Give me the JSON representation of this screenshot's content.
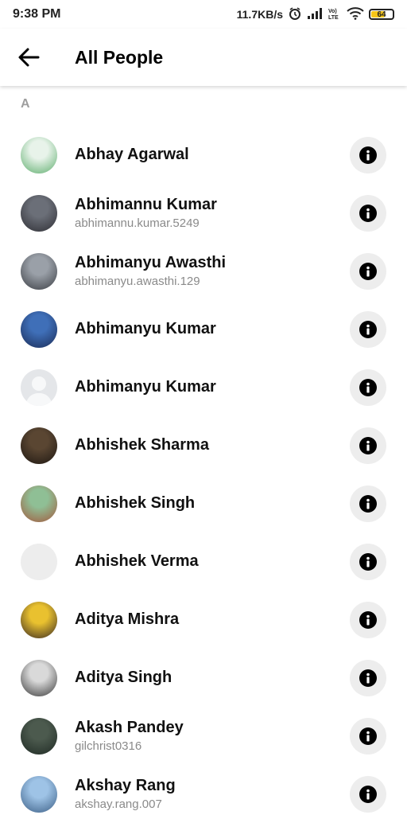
{
  "status_bar": {
    "time": "9:38 PM",
    "speed": "11.7KB/s",
    "battery": "64",
    "battery_level": 0.64,
    "icons": [
      "alarm-icon",
      "signal-icon",
      "volte-icon",
      "wifi-icon",
      "battery-icon"
    ]
  },
  "header": {
    "title": "All People",
    "back_icon": "back-arrow-icon"
  },
  "section": {
    "letter": "A"
  },
  "people": [
    {
      "name": "Abhay Agarwal",
      "username": "",
      "avatar_colors": [
        "#e8f3ea",
        "#5fae6e"
      ]
    },
    {
      "name": "Abhimannu Kumar",
      "username": "abhimannu.kumar.5249",
      "avatar_colors": [
        "#6b6f78",
        "#2f2f35"
      ]
    },
    {
      "name": "Abhimanyu Awasthi",
      "username": "abhimanyu.awasthi.129",
      "avatar_colors": [
        "#9aa0a8",
        "#3b3e44"
      ]
    },
    {
      "name": "Abhimanyu Kumar",
      "username": "",
      "avatar_colors": [
        "#3f6fb8",
        "#1b2c57"
      ]
    },
    {
      "name": "Abhimanyu Kumar",
      "username": "",
      "avatar_colors": [
        "#e3e5e8",
        "#c7cbd1"
      ]
    },
    {
      "name": "Abhishek Sharma",
      "username": "",
      "avatar_colors": [
        "#5a4632",
        "#1e1712"
      ]
    },
    {
      "name": "Abhishek Singh",
      "username": "",
      "avatar_colors": [
        "#8fbf95",
        "#a3583c"
      ]
    },
    {
      "name": "Abhishek Verma",
      "username": "",
      "avatar_colors": [
        "#ededed",
        "#ededed"
      ]
    },
    {
      "name": "Aditya Mishra",
      "username": "",
      "avatar_colors": [
        "#e9c12f",
        "#3a2a22"
      ]
    },
    {
      "name": "Aditya Singh",
      "username": "",
      "avatar_colors": [
        "#d9d9d9",
        "#3a3a3a"
      ]
    },
    {
      "name": "Akash Pandey",
      "username": "gilchrist0316",
      "avatar_colors": [
        "#4c5a4e",
        "#1f2a24"
      ]
    },
    {
      "name": "Akshay Rang",
      "username": "akshay.rang.007",
      "avatar_colors": [
        "#9ec3e6",
        "#3c5f86"
      ]
    }
  ],
  "info_icon": "info-icon"
}
